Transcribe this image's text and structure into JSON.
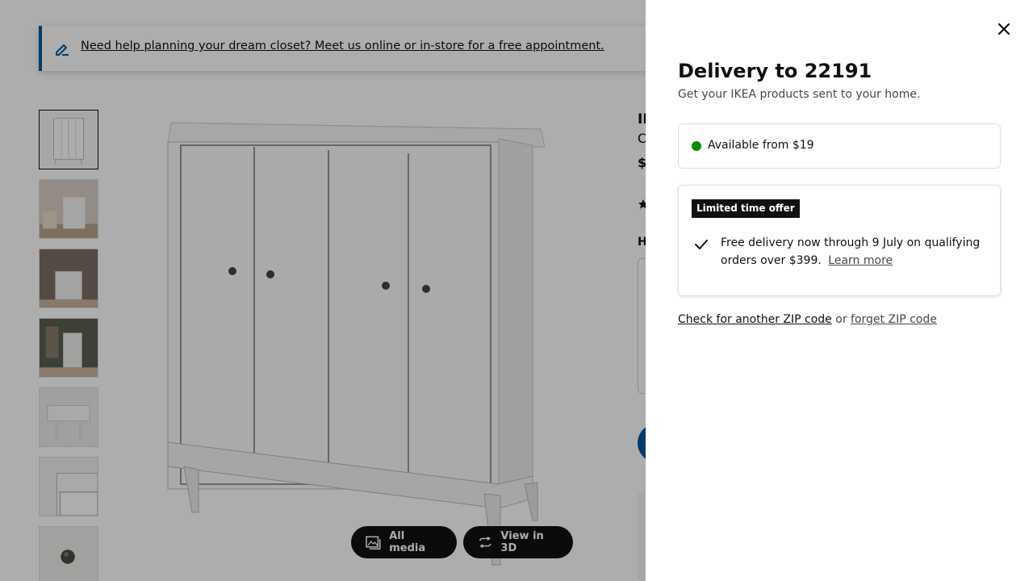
{
  "banner": {
    "icon": "pencil-icon",
    "text": "Need help planning your dream closet? Meet us online or in-store for a free appointment."
  },
  "gallery": {
    "thumbnails": [
      {
        "name": "front-view"
      },
      {
        "name": "room-view-living"
      },
      {
        "name": "room-view-hallway"
      },
      {
        "name": "room-view-entry"
      },
      {
        "name": "detail-side"
      },
      {
        "name": "detail-drawer"
      },
      {
        "name": "detail-knob"
      }
    ],
    "all_media_label": "All media",
    "view_3d_label": "View in 3D"
  },
  "product": {
    "title_partial": "ID",
    "subtitle_partial": "C",
    "price_partial": "$",
    "section_heading_partial": "H"
  },
  "drawer": {
    "title": "Delivery to 22191",
    "subtitle": "Get your IKEA products sent to your home.",
    "availability": {
      "status_color": "#0a8a00",
      "text": "Available from $19"
    },
    "offer": {
      "badge": "Limited time offer",
      "text": "Free delivery now through 9 July on qualifying orders over $399.",
      "learn_more": "Learn more"
    },
    "zip": {
      "check_link": "Check for another ZIP code",
      "or": "or",
      "forget_link": "forget ZIP code"
    }
  },
  "colors": {
    "accent_blue": "#0058a3",
    "badge_bg": "#111111",
    "available_green": "#0a8a00"
  }
}
